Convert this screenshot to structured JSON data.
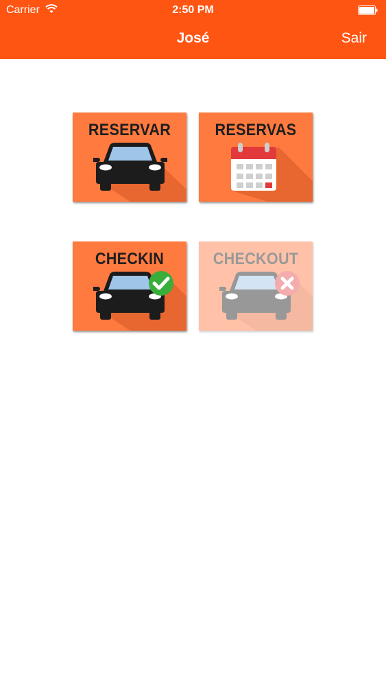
{
  "status_bar": {
    "carrier": "Carrier",
    "time": "2:50 PM"
  },
  "nav": {
    "title": "José",
    "right_button": "Sair"
  },
  "tiles": [
    {
      "label": "RESERVAR",
      "icon": "car-icon",
      "enabled": true
    },
    {
      "label": "RESERVAS",
      "icon": "calendar-icon",
      "enabled": true
    },
    {
      "label": "CHECKIN",
      "icon": "car-check-icon",
      "enabled": true
    },
    {
      "label": "CHECKOUT",
      "icon": "car-cross-icon",
      "enabled": false
    }
  ],
  "colors": {
    "accent": "#FF5512",
    "tile": "#FF7A3F",
    "check": "#3AAE3A",
    "cross": "#E8484B",
    "calendar_red": "#E23A3A"
  }
}
